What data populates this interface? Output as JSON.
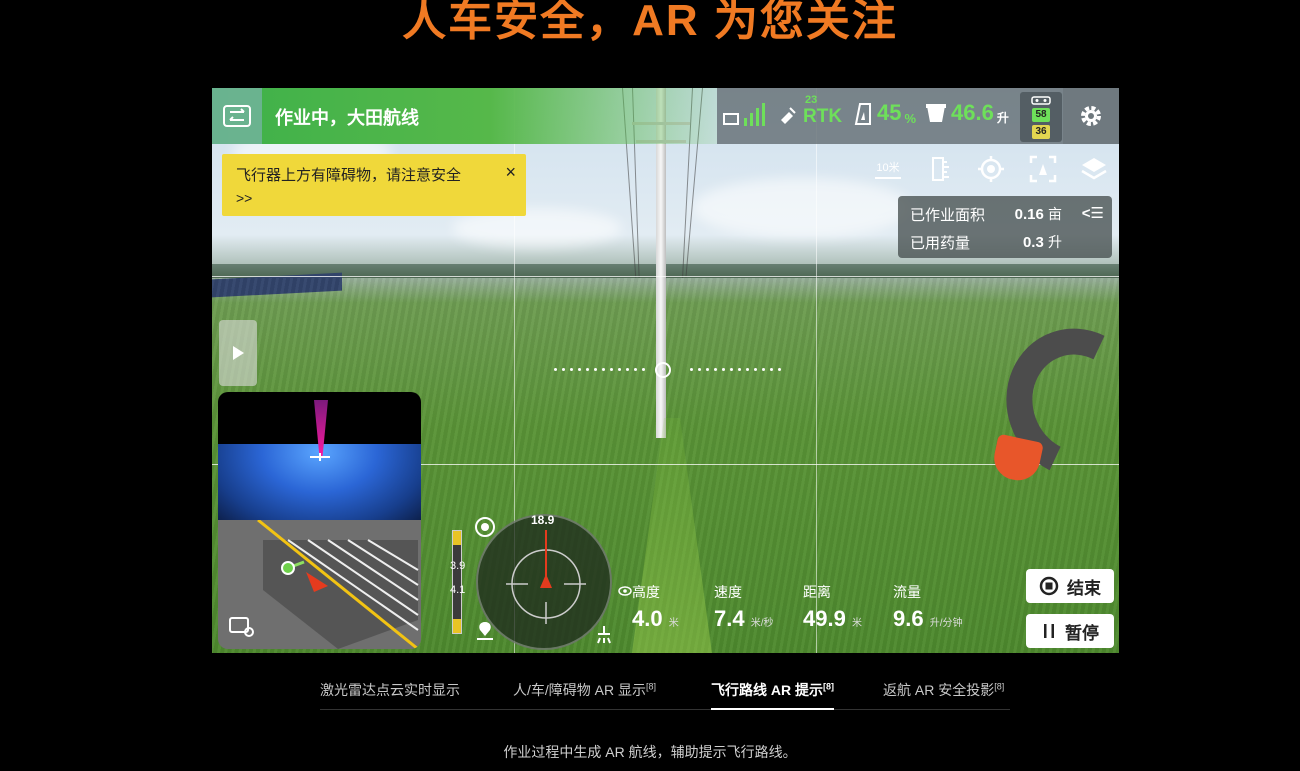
{
  "headline": "人车安全，AR 为您关注",
  "app": {
    "status": "作业中，大田航线",
    "indicators": {
      "satellites": "23",
      "rtk": "RTK",
      "battery": "45",
      "battery_unit": "%",
      "tank": "46.6",
      "tank_unit": "升",
      "rc_top": "58",
      "rc_bottom": "36"
    },
    "scale_label": "10米",
    "warning": {
      "message": "飞行器上方有障碍物，请注意安全",
      "more": ">>",
      "close": "×"
    },
    "stats": {
      "area_label": "已作业面积",
      "area_value": "0.16",
      "area_unit": "亩",
      "chem_label": "已用药量",
      "chem_value": "0.3",
      "chem_unit": "升",
      "collapse": "<☰"
    },
    "altitude_bar": {
      "upper": "3.9",
      "lower": "4.1"
    },
    "compass_heading": "18.9",
    "telemetry": [
      {
        "label": "高度",
        "value": "4.0",
        "unit": "米"
      },
      {
        "label": "速度",
        "value": "7.4",
        "unit": "米/秒"
      },
      {
        "label": "距离",
        "value": "49.9",
        "unit": "米"
      },
      {
        "label": "流量",
        "value": "9.6",
        "unit": "升/分钟"
      }
    ],
    "buttons": {
      "end": "结束",
      "pause": "暂停"
    }
  },
  "tabs": [
    {
      "label": "激光雷达点云实时显示",
      "note": ""
    },
    {
      "label": "人/车/障碍物 AR 显示",
      "note": "[8]"
    },
    {
      "label": "飞行路线 AR 提示",
      "note": "[8]"
    },
    {
      "label": "返航 AR 安全投影",
      "note": "[8]"
    }
  ],
  "caption": "作业过程中生成 AR 航线，辅助提示飞行路线。",
  "colors": {
    "accent_orange": "#f07a23",
    "status_green": "#3eb14a",
    "indicator_green": "#6ee05a",
    "warning_yellow": "#f0d83a"
  }
}
